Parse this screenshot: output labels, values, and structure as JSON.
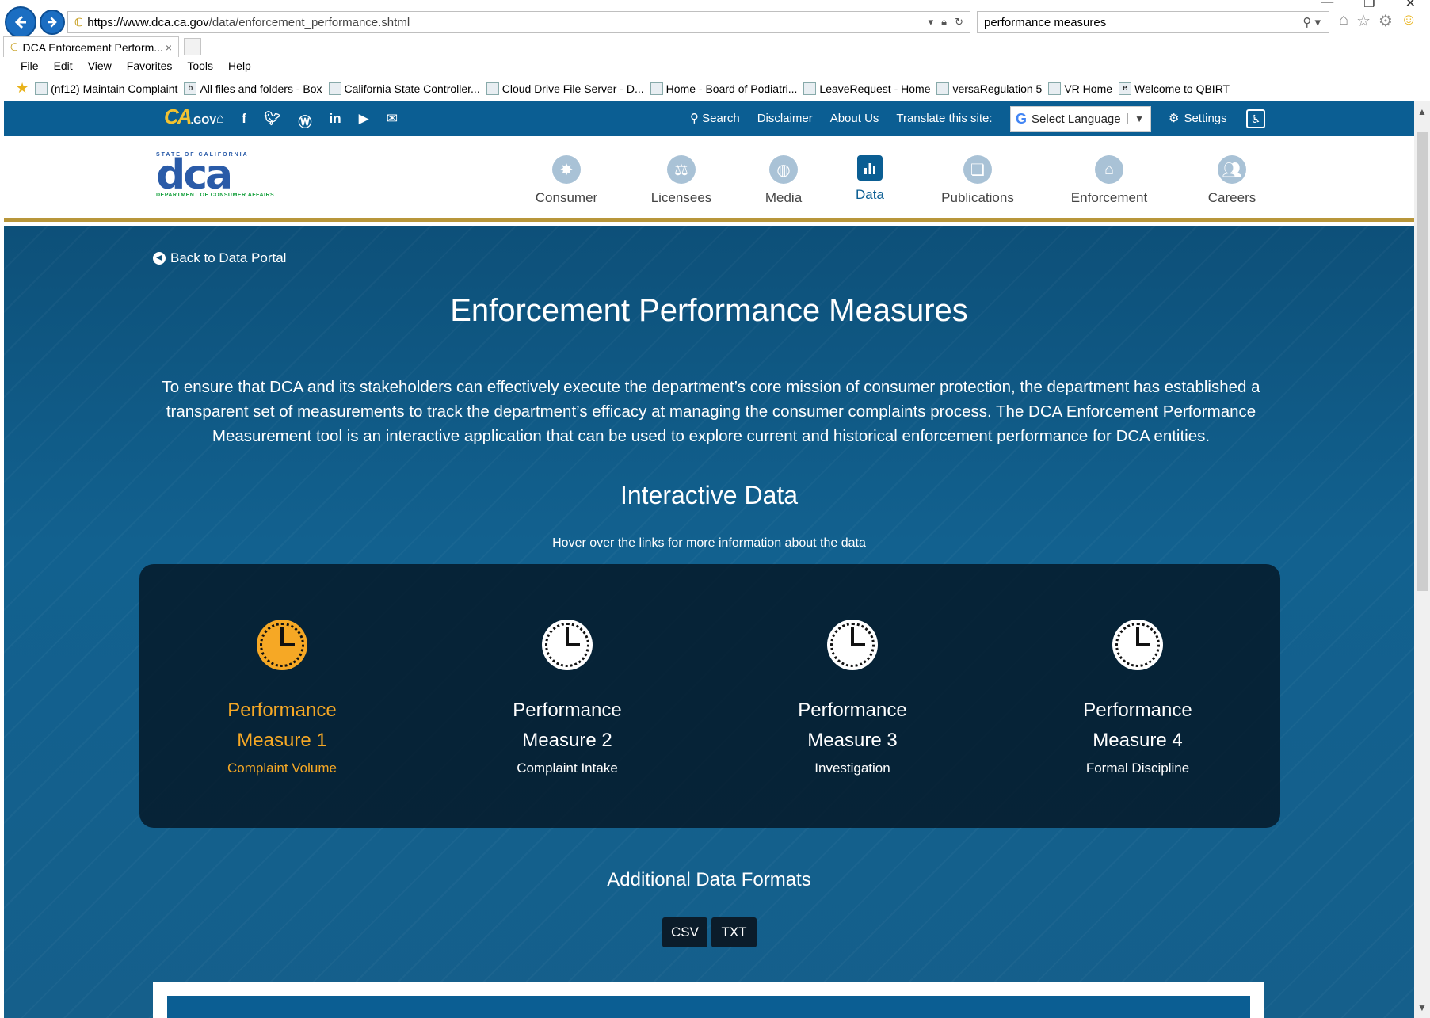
{
  "browser": {
    "url_domain": "https://www.dca.ca.gov",
    "url_path": "/data/enforcement_performance.shtml",
    "search_query": "performance measures",
    "tab_title": "DCA Enforcement Perform...",
    "tab_close": "×",
    "menu": [
      "File",
      "Edit",
      "View",
      "Favorites",
      "Tools",
      "Help"
    ],
    "favorites": [
      "(nf12) Maintain Complaint",
      "All files and folders - Box",
      "California State Controller...",
      "Cloud Drive File Server - D...",
      "Home - Board of Podiatri...",
      "LeaveRequest - Home",
      "versaRegulation 5",
      "VR Home",
      "Welcome to QBIRT"
    ]
  },
  "utility": {
    "logo_text": "CA",
    "logo_sub": ".GOV",
    "search": "Search",
    "disclaimer": "Disclaimer",
    "about": "About Us",
    "translate": "Translate this site:",
    "language": "Select Language",
    "settings": "Settings"
  },
  "header": {
    "logo_top": "STATE OF CALIFORNIA",
    "logo_main": "dca",
    "logo_bottom": "DEPARTMENT OF CONSUMER AFFAIRS",
    "nav": [
      {
        "label": "Consumer",
        "icon": "badge-icon"
      },
      {
        "label": "Licensees",
        "icon": "scales-icon"
      },
      {
        "label": "Media",
        "icon": "globe-icon"
      },
      {
        "label": "Data",
        "icon": "bar-chart-icon"
      },
      {
        "label": "Publications",
        "icon": "book-icon"
      },
      {
        "label": "Enforcement",
        "icon": "capitol-icon"
      },
      {
        "label": "Careers",
        "icon": "people-icon"
      }
    ]
  },
  "hero": {
    "back_link": "Back to Data Portal",
    "title": "Enforcement Performance Measures",
    "description": "To ensure that DCA and its stakeholders can effectively execute the department’s core mission of consumer protection, the department has established a transparent set of measurements to track the department’s efficacy at managing the consumer complaints process. The DCA Enforcement Performance Measurement tool is an interactive application that can be used to explore current and historical enforcement performance for DCA entities.",
    "interactive_title": "Interactive Data",
    "hover_note": "Hover over the links for more information about the data",
    "measures": [
      {
        "line1": "Performance",
        "line2": "Measure 1",
        "sub": "Complaint Volume"
      },
      {
        "line1": "Performance",
        "line2": "Measure 2",
        "sub": "Complaint Intake"
      },
      {
        "line1": "Performance",
        "line2": "Measure 3",
        "sub": "Investigation"
      },
      {
        "line1": "Performance",
        "line2": "Measure 4",
        "sub": "Formal Discipline"
      }
    ],
    "additional_title": "Additional Data Formats",
    "csv": "CSV",
    "txt": "TXT"
  },
  "colors": {
    "primary": "#0b5e93",
    "accent": "#f6a825",
    "header_rule": "#b8963a"
  }
}
